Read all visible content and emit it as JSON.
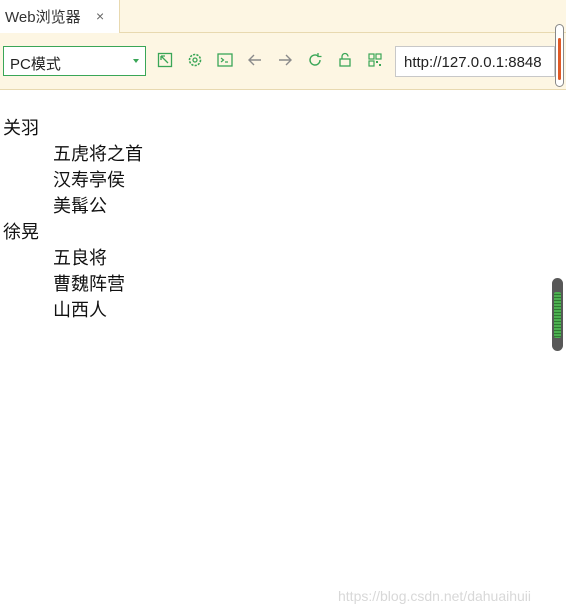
{
  "tab": {
    "title": "Web浏览器",
    "close_glyph": "×"
  },
  "toolbar": {
    "mode_select_value": "PC模式",
    "icons": [
      "resize-icon",
      "gear-icon",
      "console-icon",
      "back-icon",
      "forward-icon",
      "refresh-icon",
      "lock-icon",
      "qr-icon"
    ],
    "url": "http://127.0.0.1:8848"
  },
  "content": {
    "items": [
      {
        "name": "关羽",
        "details": [
          "五虎将之首",
          "汉寿亭侯",
          "美髯公"
        ]
      },
      {
        "name": "徐晃",
        "details": [
          "五良将",
          "曹魏阵营",
          "山西人"
        ]
      }
    ]
  },
  "watermark": "https://blog.csdn.net/dahuaihuii",
  "colors": {
    "accent_green": "#3aa657",
    "toolbar_bg": "#fdf6e3",
    "scroll_orange": "#e05a26"
  }
}
